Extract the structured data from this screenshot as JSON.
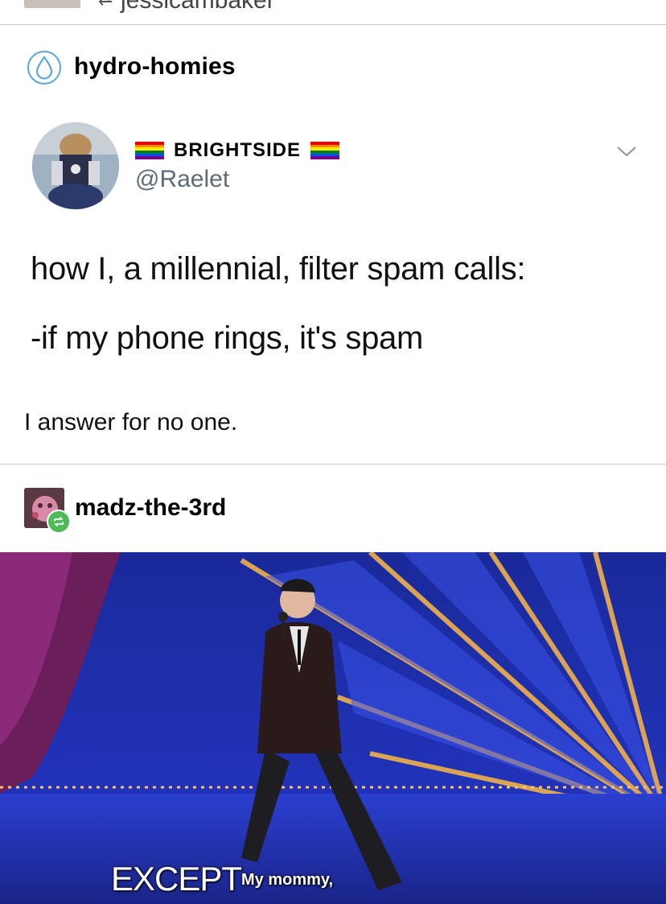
{
  "top": {
    "username": "jessicambaker"
  },
  "post1": {
    "blog_name": "hydro-homies",
    "tweet": {
      "display_name": "BRIGHTSIDE",
      "handle": "@Raelet",
      "line1": "how I, a millennial, filter spam calls:",
      "line2": "-if my phone rings, it's spam"
    },
    "caption": "I answer for no one."
  },
  "post2": {
    "blog_name": "madz-the-3rd",
    "subtitle_big": "EXCEPT",
    "subtitle_small": "My mommy,"
  },
  "icons": {
    "blog_icon": "water-drop-icon",
    "reblog_icon": "reblog-icon",
    "menu_icon": "chevron-down-icon"
  },
  "colors": {
    "handle": "#5b6b77",
    "water_drop": "#5aa6e0",
    "reblog_badge": "#4dbb55",
    "divider": "#c8c8c8"
  }
}
